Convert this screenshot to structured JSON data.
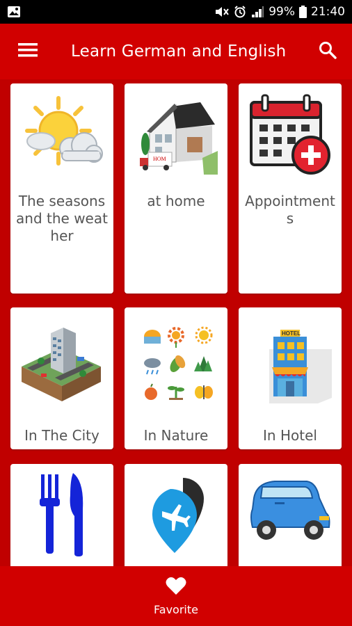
{
  "status_bar": {
    "battery": "99%",
    "time": "21:40"
  },
  "app_bar": {
    "title": "Learn German and English",
    "menu_icon": "hamburger-menu-icon",
    "search_icon": "search-icon"
  },
  "categories": [
    {
      "label": "The seasons and the weather",
      "icon": "weather-icon"
    },
    {
      "label": "at home",
      "icon": "house-icon"
    },
    {
      "label": "Appointments",
      "icon": "calendar-icon"
    },
    {
      "label": "In The City",
      "icon": "city-icon"
    },
    {
      "label": "In Nature",
      "icon": "nature-icon"
    },
    {
      "label": "In Hotel",
      "icon": "hotel-icon"
    },
    {
      "label": "",
      "icon": "fork-knife-icon"
    },
    {
      "label": "",
      "icon": "airport-pin-icon"
    },
    {
      "label": "",
      "icon": "car-icon"
    }
  ],
  "bottom_bar": {
    "favorite_label": "Favorite",
    "favorite_icon": "heart-icon"
  },
  "colors": {
    "primary": "#d10000",
    "background": "#c00000",
    "card": "#ffffff",
    "text": "#555555"
  }
}
